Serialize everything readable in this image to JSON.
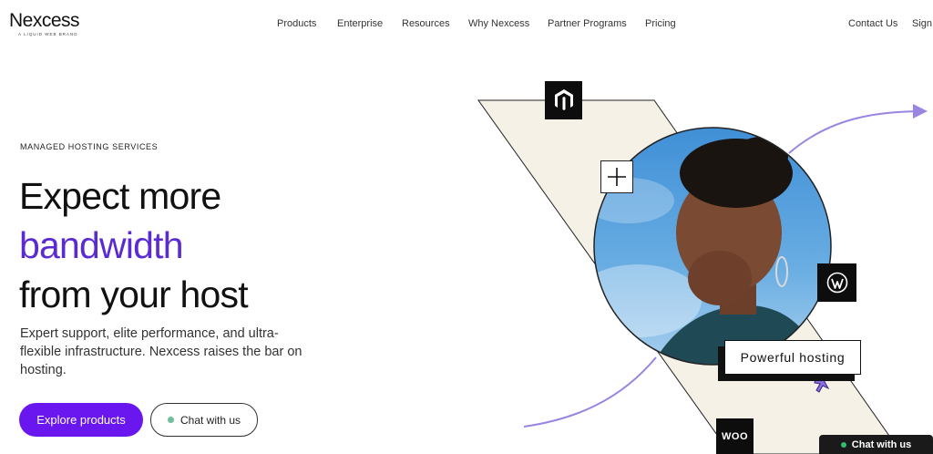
{
  "brand": {
    "name": "Nexcess",
    "tagline": "A LIQUID WEB BRAND"
  },
  "nav": {
    "items": [
      "Products",
      "Enterprise",
      "Resources",
      "Why Nexcess",
      "Partner Programs",
      "Pricing"
    ],
    "contact": "Contact Us",
    "sign": "Sign"
  },
  "hero": {
    "eyebrow": "MANAGED HOSTING SERVICES",
    "headline_1": "Expect more",
    "headline_2": "bandwidth",
    "headline_3": "from your host",
    "subtext": "Expert support, elite performance, and ultra-flexible infrastructure. Nexcess raises the bar on hosting.",
    "primary_cta": "Explore products",
    "secondary_cta": "Chat with us"
  },
  "illustration": {
    "card_label": "Powerful hosting",
    "woo_badge": "WOO"
  },
  "chat_widget": {
    "label": "Chat with us"
  },
  "colors": {
    "accent": "#6a16ee",
    "headline_accent": "#5b2bd2",
    "beige": "#f6f1e7",
    "arrow": "#9a85e0"
  }
}
